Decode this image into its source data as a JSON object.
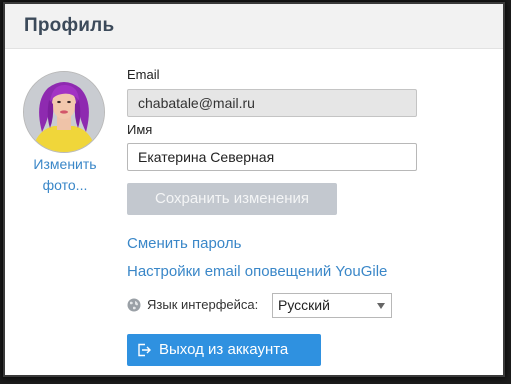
{
  "header": {
    "title": "Профиль"
  },
  "avatar": {
    "change_photo_label": "Изменить фото..."
  },
  "form": {
    "email_label": "Email",
    "email_value": "chabatale@mail.ru",
    "name_label": "Имя",
    "name_value": "Екатерина Северная",
    "save_label": "Сохранить изменения"
  },
  "links": {
    "change_password": "Сменить пароль",
    "notification_settings": "Настройки email оповещений YouGile"
  },
  "language": {
    "label": "Язык интерфейса:",
    "selected": "Русский"
  },
  "logout": {
    "label": "Выход из аккаунта"
  },
  "colors": {
    "accent": "#2f91e0",
    "link": "#3a87c8",
    "disabled_button": "#c3c8cf"
  }
}
